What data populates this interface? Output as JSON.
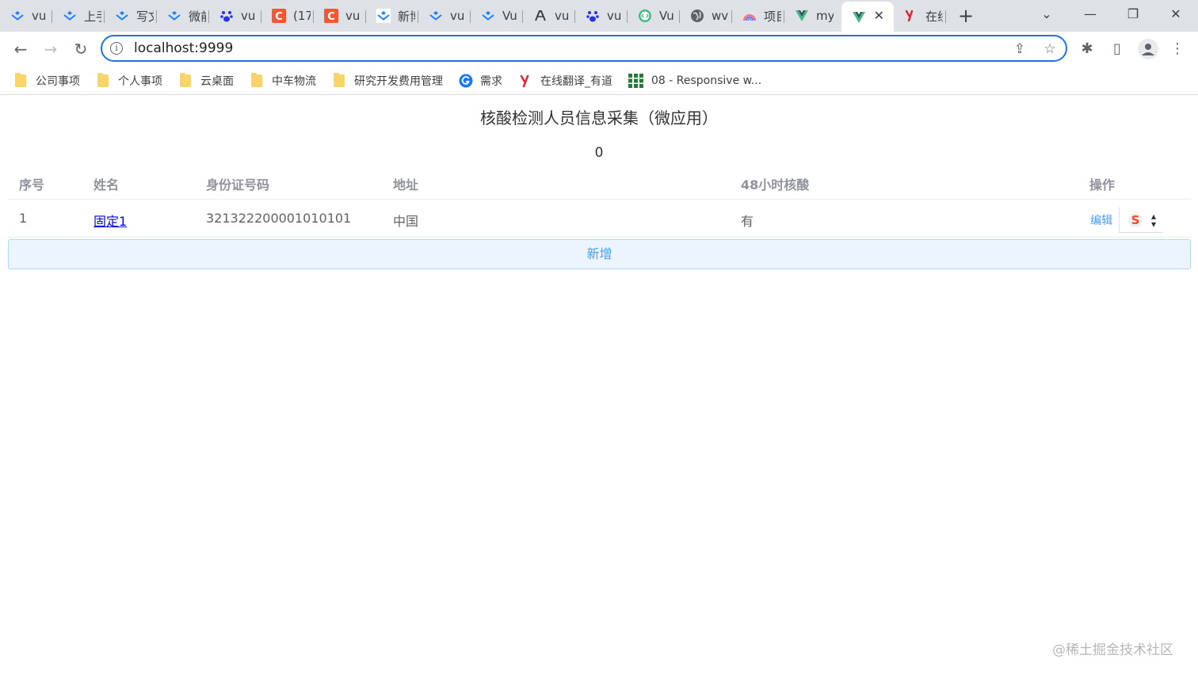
{
  "browser": {
    "tabs": [
      {
        "title": "vu",
        "icon": "juejin-icon",
        "color": "#1e80ff"
      },
      {
        "title": "上手",
        "icon": "juejin-icon",
        "color": "#1e80ff"
      },
      {
        "title": "写文",
        "icon": "juejin-icon",
        "color": "#1e80ff"
      },
      {
        "title": "微前",
        "icon": "juejin-icon",
        "color": "#1e80ff"
      },
      {
        "title": "vu",
        "icon": "baidu-icon",
        "color": "#2932e1"
      },
      {
        "title": "(17",
        "icon": "csdn-icon",
        "color": "#fc5531"
      },
      {
        "title": "vu",
        "icon": "csdn-icon",
        "color": "#fc5531"
      },
      {
        "title": "新博",
        "icon": "juejin-icon",
        "color": "#1e80ff"
      },
      {
        "title": "vu",
        "icon": "juejin-icon",
        "color": "#1e80ff"
      },
      {
        "title": "Vu",
        "icon": "juejin-icon",
        "color": "#1e80ff"
      },
      {
        "title": "vu",
        "icon": "compass-icon",
        "color": "#3c4043"
      },
      {
        "title": "vu",
        "icon": "baidu-icon",
        "color": "#2932e1"
      },
      {
        "title": "Vu",
        "icon": "code-icon",
        "color": "#42b983"
      },
      {
        "title": "wv",
        "icon": "globe-icon",
        "color": "#5f6368"
      },
      {
        "title": "项目",
        "icon": "rainbow-icon",
        "color": "#7b61ff"
      },
      {
        "title": "my",
        "icon": "vue-icon",
        "color": "#42b883"
      },
      {
        "title": "",
        "icon": "vue-icon",
        "color": "#42b883",
        "active": true
      },
      {
        "title": "在线",
        "icon": "youdao-icon",
        "color": "#e8212e"
      }
    ],
    "new_tab_label": "+",
    "address": "localhost:9999",
    "bookmarks": [
      {
        "label": "公司事项",
        "icon": "folder-icon"
      },
      {
        "label": "个人事项",
        "icon": "folder-icon"
      },
      {
        "label": "云桌面",
        "icon": "folder-icon"
      },
      {
        "label": "中车物流",
        "icon": "folder-icon"
      },
      {
        "label": "研究开发费用管理",
        "icon": "folder-icon"
      },
      {
        "label": "需求",
        "icon": "swirl-icon"
      },
      {
        "label": "在线翻译_有道",
        "icon": "youdao-icon"
      },
      {
        "label": "08 - Responsive w...",
        "icon": "grid-icon"
      }
    ]
  },
  "app": {
    "title": "核酸检测人员信息采集（微应用）",
    "counter": "0",
    "table": {
      "columns": [
        "序号",
        "姓名",
        "身份证号码",
        "地址",
        "48小时核酸",
        "操作"
      ],
      "rows": [
        {
          "index": "1",
          "name": "固定1",
          "id_number": "321322200001010101",
          "address": "中国",
          "nucleic_48h": "有",
          "action": "编辑"
        }
      ]
    },
    "add_button": "新增"
  },
  "watermark": "@稀土掘金技术社区",
  "colors": {
    "accent": "#409eff",
    "focus_ring": "#1a73e8",
    "header_text": "#909399",
    "cell_text": "#606266"
  }
}
